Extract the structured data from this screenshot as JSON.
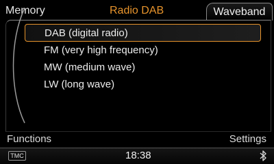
{
  "header": {
    "left_tab": "Memory",
    "title": "Radio DAB",
    "right_tab": "Waveband"
  },
  "waveband_list": {
    "items": [
      {
        "label": "DAB (digital radio)",
        "selected": true
      },
      {
        "label": "FM (very high frequency)",
        "selected": false
      },
      {
        "label": "MW (medium wave)",
        "selected": false
      },
      {
        "label": "LW (long wave)",
        "selected": false
      }
    ]
  },
  "function_bar": {
    "left": "Functions",
    "right": "Settings"
  },
  "status_bar": {
    "tmc": "TMC",
    "time": "18:38",
    "bluetooth_icon": "bluetooth-icon"
  },
  "colors": {
    "accent": "#e8942c",
    "background": "#000000",
    "text": "#e8e8e8"
  }
}
